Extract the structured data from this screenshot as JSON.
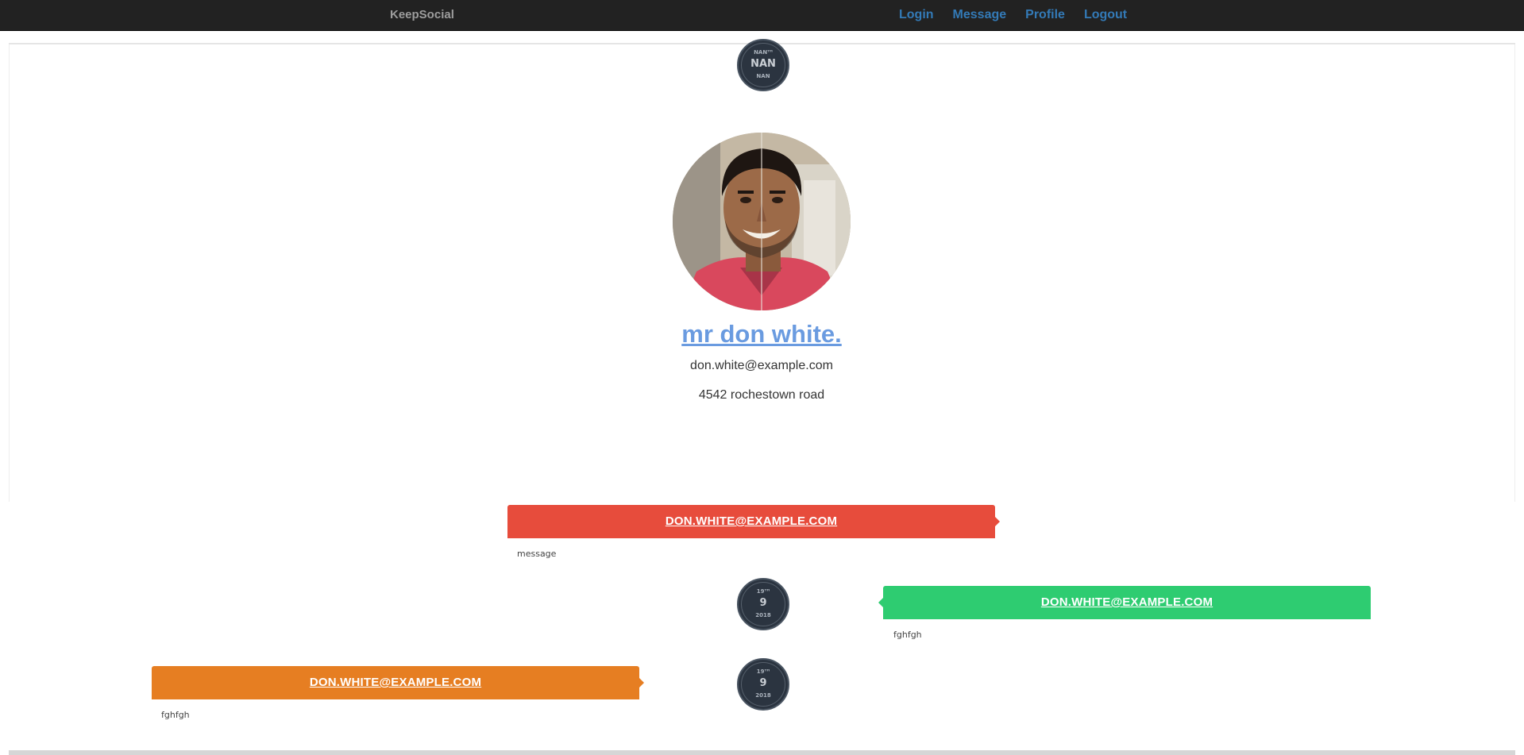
{
  "navbar": {
    "brand": "KeepSocial",
    "links": [
      "Login",
      "Message",
      "Profile",
      "Logout"
    ]
  },
  "profile": {
    "date_badge": {
      "day": "NANᵀᴴ",
      "main": "NAN",
      "year": "NAN"
    },
    "name": "mr don white.",
    "email": "don.white@example.com",
    "address": "4542 rochestown road"
  },
  "timeline": [
    {
      "author": "DON.WHITE@EXAMPLE.COM",
      "body": "message",
      "color": "#e74c3c",
      "side": "left"
    },
    {
      "author": "DON.WHITE@EXAMPLE.COM",
      "body": "fghfgh",
      "color": "#2ecc71",
      "side": "right",
      "date": {
        "day": "19ᵀᴴ",
        "main": "9",
        "year": "2018"
      }
    },
    {
      "author": "DON.WHITE@EXAMPLE.COM",
      "body": "fghfgh",
      "color": "#e67e22",
      "side": "left",
      "date": {
        "day": "19ᵀᴴ",
        "main": "9",
        "year": "2018"
      }
    }
  ]
}
